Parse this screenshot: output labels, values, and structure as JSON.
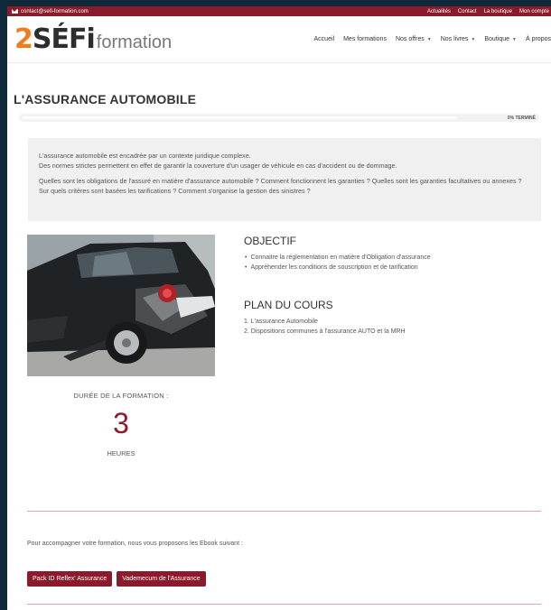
{
  "topbar": {
    "email": "contact@sefi-formation.com",
    "links": [
      "Actualités",
      "Contact",
      "La boutique",
      "Mon compte"
    ]
  },
  "brand": {
    "logo_part1": "2",
    "logo_part2": "SÉFi",
    "logo_part3": "formation"
  },
  "nav": [
    {
      "label": "Accueil",
      "dropdown": false
    },
    {
      "label": "Mes formations",
      "dropdown": false
    },
    {
      "label": "Nos offres",
      "dropdown": true
    },
    {
      "label": "Nos livres",
      "dropdown": true
    },
    {
      "label": "Boutique",
      "dropdown": true
    },
    {
      "label": "À propos",
      "dropdown": false
    }
  ],
  "page": {
    "title": "L'ASSURANCE AUTOMOBILE",
    "progress_value": 0,
    "progress_label": "0% TERMINÉ"
  },
  "intro": {
    "p1_line1": "L'assurance automobile est encadrée par un contexte juridique complexe.",
    "p1_line2": "Des normes strictes permettent en effet de garantir la couverture d'un usager de véhicule en cas d'accident ou de dommage.",
    "p2": "Quelles sont les obligations de l'assuré en matière d'assurance automobile ? Comment fonctionnent les garanties ? Quelles sont les garanties facultatives ou annexes ? Sur quels critères sont basées les tarifications ? Comment s'organise la gestion des sinistres ?"
  },
  "objectif": {
    "heading": "OBJECTIF",
    "items": [
      "Connaitre la réglementation en matière d'Obligation d'assurance",
      "Appréhender les conditions de souscription et de tarification"
    ]
  },
  "plan": {
    "heading": "PLAN DU COURS",
    "items": [
      "1. L'assurance Automobile",
      "2. Dispositions communes à l'assurance AUTO et la MRH"
    ]
  },
  "duree": {
    "label": "DURÉE DE LA FORMATION :",
    "value": "3",
    "unit": "HEURES"
  },
  "ebook": {
    "text": "Pour accompagner votre formation, nous vous proposons les Ebook suivant :",
    "buttons": [
      "Pack ID Reflex' Assurance",
      "Vademecum de l'Assurance"
    ]
  },
  "colors": {
    "brand_red": "#8b1a2b",
    "logo_orange": "#f07d1a",
    "page_bg": "#0e2a3a"
  }
}
